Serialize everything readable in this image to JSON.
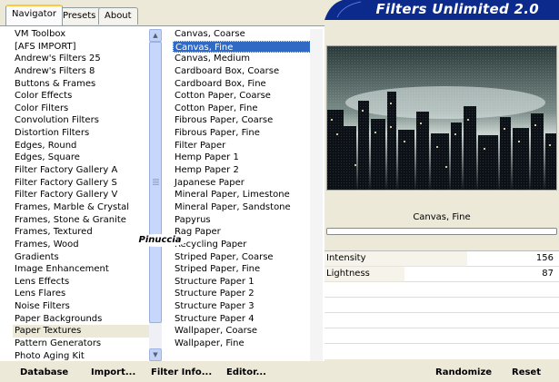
{
  "tabs": [
    {
      "label": "Navigator",
      "active": true
    },
    {
      "label": "Presets",
      "active": false
    },
    {
      "label": "About",
      "active": false
    }
  ],
  "banner": {
    "title": "Filters Unlimited 2.0"
  },
  "categories": {
    "selected": "Paper Textures",
    "items": [
      "VM Toolbox",
      "[AFS IMPORT]",
      "Andrew's Filters 25",
      "Andrew's Filters 8",
      "Buttons & Frames",
      "Color Effects",
      "Color Filters",
      "Convolution Filters",
      "Distortion Filters",
      "Edges, Round",
      "Edges, Square",
      "Filter Factory Gallery A",
      "Filter Factory Gallery S",
      "Filter Factory Gallery V",
      "Frames, Marble & Crystal",
      "Frames, Stone & Granite",
      "Frames, Textured",
      "Frames, Wood",
      "Gradients",
      "Image Enhancement",
      "Lens Effects",
      "Lens Flares",
      "Noise Filters",
      "Paper Backgrounds",
      "Paper Textures",
      "Pattern Generators",
      "Photo Aging Kit"
    ]
  },
  "filters": {
    "selected": "Canvas, Fine",
    "items": [
      "Canvas, Coarse",
      "Canvas, Fine",
      "Canvas, Medium",
      "Cardboard Box, Coarse",
      "Cardboard Box, Fine",
      "Cotton Paper, Coarse",
      "Cotton Paper, Fine",
      "Fibrous Paper, Coarse",
      "Fibrous Paper, Fine",
      "Filter Paper",
      "Hemp Paper 1",
      "Hemp Paper 2",
      "Japanese Paper",
      "Mineral Paper, Limestone",
      "Mineral Paper, Sandstone",
      "Papyrus",
      "Rag Paper",
      "Recycling Paper",
      "Striped Paper, Coarse",
      "Striped Paper, Fine",
      "Structure Paper 1",
      "Structure Paper 2",
      "Structure Paper 3",
      "Structure Paper 4",
      "Wallpaper, Coarse",
      "Wallpaper, Fine"
    ]
  },
  "watermark": "Pinuccia",
  "preview": {
    "filter_name": "Canvas, Fine"
  },
  "sliders": [
    {
      "label": "Intensity",
      "value": "156",
      "fraction": 0.61
    },
    {
      "label": "Lightness",
      "value": "87",
      "fraction": 0.34
    }
  ],
  "buttons": {
    "database": "Database",
    "import": "Import...",
    "filter_info": "Filter Info...",
    "editor": "Editor...",
    "randomize": "Randomize",
    "reset": "Reset"
  },
  "colors": {
    "banner": "#0c2a8c",
    "selection": "#316ac5",
    "face": "#ece9d8"
  }
}
